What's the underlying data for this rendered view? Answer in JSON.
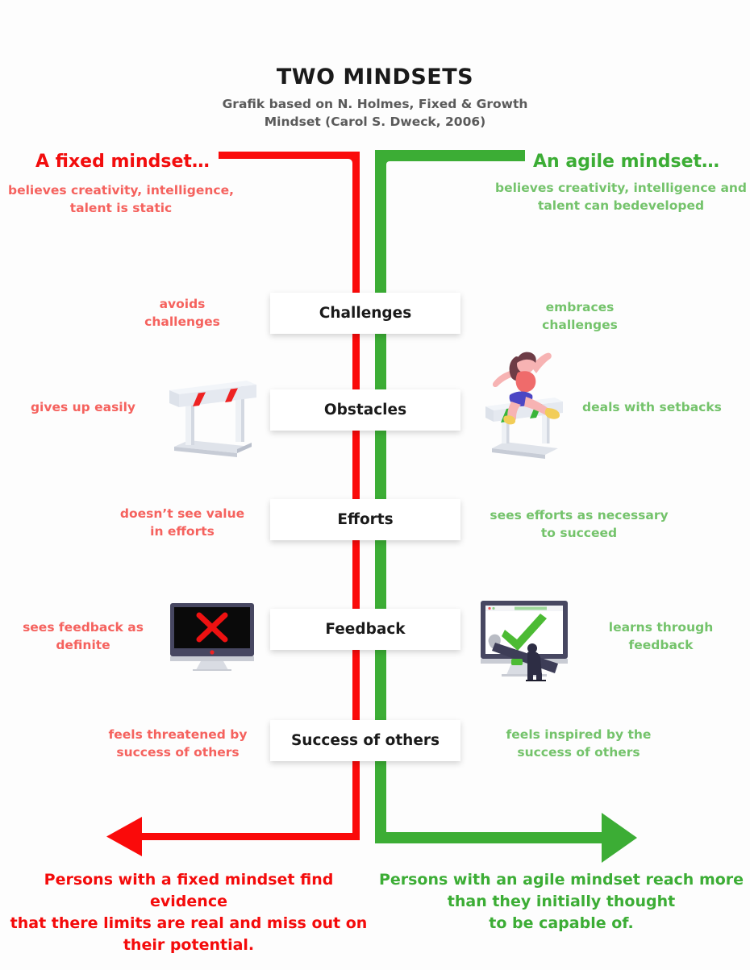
{
  "header": {
    "title": "TWO MINDSETS",
    "subtitle_line1": "Grafik based on N. Holmes, Fixed & Growth",
    "subtitle_line2": "Mindset (Carol S. Dweck, 2006)"
  },
  "columns": {
    "fixed": {
      "heading": "A fixed mindset…",
      "description_line1": "believes creativity, intelligence,",
      "description_line2": "talent is static",
      "conclusion_line1": "Persons with a fixed mindset find evidence",
      "conclusion_line2": "that there limits are real and miss out on",
      "conclusion_line3": "their potential.",
      "color": "#f20d0d",
      "light_color": "#f5625e"
    },
    "agile": {
      "heading": "An agile mindset…",
      "description_line1": "believes creativity, intelligence and",
      "description_line2": "talent can bedeveloped",
      "conclusion_line1": "Persons with an agile mindset reach more",
      "conclusion_line2": "than they initially thought",
      "conclusion_line3": "to be capable of.",
      "color": "#3cad35",
      "light_color": "#74c36b"
    }
  },
  "rows": [
    {
      "topic": "Challenges",
      "left_line1": "avoids",
      "left_line2": "challenges",
      "right_line1": "embraces",
      "right_line2": "challenges",
      "left_illustration": "",
      "right_illustration": ""
    },
    {
      "topic": "Obstacles",
      "left_line1": "gives up easily",
      "left_line2": "",
      "right_line1": "deals with setbacks",
      "right_line2": "",
      "left_illustration": "hurdle-red-icon",
      "right_illustration": "runner-hurdle-green-icon"
    },
    {
      "topic": "Efforts",
      "left_line1": "doesn’t see value",
      "left_line2": "in efforts",
      "right_line1": "sees efforts as necessary",
      "right_line2": "to succeed",
      "left_illustration": "",
      "right_illustration": ""
    },
    {
      "topic": "Feedback",
      "left_line1": "sees feedback as",
      "left_line2": "definite",
      "right_line1": "learns through",
      "right_line2": "feedback",
      "left_illustration": "monitor-red-cross-icon",
      "right_illustration": "monitor-green-check-icon"
    },
    {
      "topic": "Success of others",
      "left_line1": "feels threatened by",
      "left_line2": "success of others",
      "right_line1": "feels inspired by the",
      "right_line2": "success of others",
      "left_illustration": "",
      "right_illustration": ""
    }
  ]
}
